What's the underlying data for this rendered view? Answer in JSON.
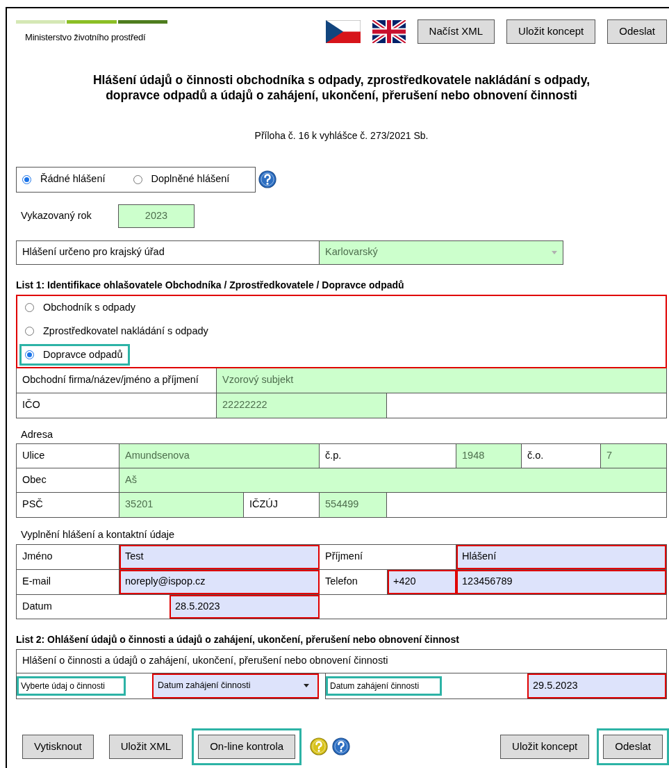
{
  "header": {
    "ministry": "Ministerstvo životního prostředí",
    "buttons": [
      "Načíst XML",
      "Uložit koncept",
      "Odeslat"
    ]
  },
  "title_lines": [
    "Hlášení údajů o činnosti obchodníka s odpady, zprostředkovatele nakládání s odpady,",
    "dopravce odpadů a údajů o zahájení, ukončení, přerušení nebo obnovení činnosti"
  ],
  "subtitle": "Příloha č. 16 k vyhlášce č. 273/2021 Sb.",
  "report_type": [
    {
      "label": "Řádné hlášení",
      "selected": true
    },
    {
      "label": "Doplněné hlášení",
      "selected": false
    }
  ],
  "year": {
    "label": "Vykazovaný rok",
    "value": "2023"
  },
  "region": {
    "label": "Hlášení určeno pro krajský úřad",
    "value": "Karlovarský"
  },
  "list1": {
    "heading": "List 1: Identifikace ohlašovatele Obchodníka / Zprostředkovatele / Dopravce odpadů",
    "invalid": true,
    "options": [
      {
        "label": "Obchodník s odpady",
        "selected": false,
        "highlighted": false
      },
      {
        "label": "Zprostředkovatel nakládání s odpady",
        "selected": false,
        "highlighted": false
      },
      {
        "label": "Dopravce odpadů",
        "selected": true,
        "highlighted": true
      }
    ],
    "company": {
      "label": "Obchodní firma/název/jméno a příjmení",
      "value": "Vzorový subjekt"
    },
    "ico": {
      "label": "IČO",
      "value": "22222222"
    }
  },
  "address": {
    "heading": "Adresa",
    "street": {
      "label": "Ulice",
      "value": "Amundsenova"
    },
    "house_number": {
      "label": "č.p.",
      "value": "1948"
    },
    "orientation_number": {
      "label": "č.o.",
      "value": "7"
    },
    "city": {
      "label": "Obec",
      "value": "Aš"
    },
    "zip": {
      "label": "PSČ",
      "value": "35201"
    },
    "municipality_code": {
      "label": "IČZÚJ",
      "value": "554499"
    }
  },
  "contact": {
    "heading": "Vyplnění hlášení a kontaktní údaje",
    "first_name": {
      "label": "Jméno",
      "value": "Test",
      "invalid": true
    },
    "last_name": {
      "label": "Příjmení",
      "value": "Hlášení",
      "invalid": true
    },
    "email": {
      "label": "E-mail",
      "value": "noreply@ispop.cz",
      "invalid": true
    },
    "phone": {
      "label": "Telefon",
      "prefix": "+420",
      "prefix_invalid": true,
      "number": "123456789",
      "number_invalid": true
    },
    "date": {
      "label": "Datum",
      "value": "28.5.2023",
      "invalid": true
    }
  },
  "list2": {
    "heading": "List 2: Ohlášení údajů o činnosti a údajů o zahájení, ukončení, přerušení nebo obnovení činnost",
    "description": "Hlášení o činnosti a údajů o zahájení, ukončení, přerušení nebo obnovení činnosti",
    "select_label": {
      "text": "Vyberte údaj o činnosti",
      "highlighted": true
    },
    "select": {
      "value": "Datum zahájení činnosti",
      "invalid": true
    },
    "date_label": {
      "text": "Datum zahájení činnosti",
      "highlighted": true
    },
    "date": {
      "value": "29.5.2023",
      "invalid": true
    }
  },
  "footer": {
    "left_buttons": [
      {
        "label": "Vytisknout",
        "highlighted": false
      },
      {
        "label": "Uložit XML",
        "highlighted": false
      },
      {
        "label": "On-line kontrola",
        "highlighted": true
      }
    ],
    "right_buttons": [
      {
        "label": "Uložit koncept",
        "highlighted": false
      },
      {
        "label": "Odeslat",
        "highlighted": true
      }
    ]
  }
}
